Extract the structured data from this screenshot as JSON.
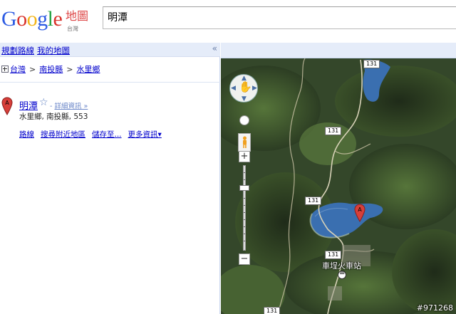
{
  "header": {
    "logo_letters": [
      "G",
      "o",
      "o",
      "g",
      "l",
      "e"
    ],
    "logo_colors": [
      "#2d5be3",
      "#d9322b",
      "#f2b51b",
      "#2d5be3",
      "#27a345",
      "#d9322b"
    ],
    "product": "地圖",
    "region": "台灣",
    "search_value": "明潭"
  },
  "nav": {
    "directions": "規劃路線",
    "my_maps": "我的地圖",
    "collapse": "«"
  },
  "breadcrumb": {
    "items": [
      "台灣",
      "南投縣",
      "水里鄉"
    ],
    "separator": ">"
  },
  "result": {
    "marker": "A",
    "title": "明潭",
    "star": "☆",
    "details_prefix": "-",
    "details": "詳細資訊 »",
    "address": "水里鄉, 南投縣, 553",
    "actions": [
      "路線",
      "搜尋附近地區",
      "儲存至...",
      "更多資訊▾"
    ]
  },
  "map": {
    "zoom_in": "+",
    "zoom_out": "−",
    "road_shields": [
      "131",
      "131",
      "131",
      "131",
      "131"
    ],
    "station_label": "車埕火車站",
    "pin_marker": "A",
    "watermark": "#971268",
    "colors": {
      "water": "#3a6fb0",
      "forest_dark": "#22301c",
      "forest_light": "#4d6a35",
      "pin": "#d73f3a"
    }
  }
}
